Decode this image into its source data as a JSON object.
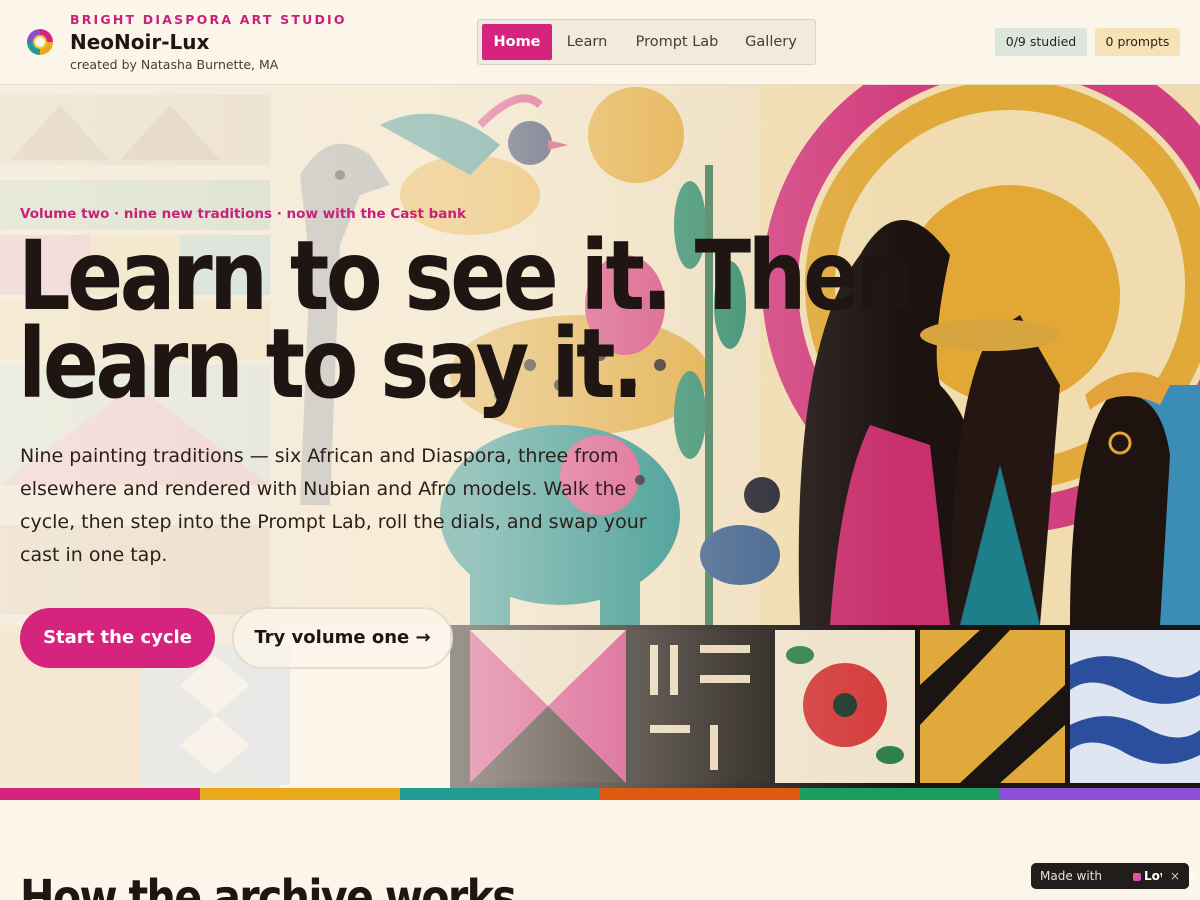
{
  "header": {
    "studio": "BRIGHT DIASPORA ART STUDIO",
    "brand": "NeoNoir-Lux",
    "byline": "created by Natasha Burnette, MA",
    "logo_icon": "ring-logo-icon"
  },
  "nav": {
    "items": [
      {
        "label": "Home",
        "active": true
      },
      {
        "label": "Learn",
        "active": false
      },
      {
        "label": "Prompt Lab",
        "active": false
      },
      {
        "label": "Gallery",
        "active": false
      }
    ]
  },
  "stats": {
    "studied": "0/9 studied",
    "prompts": "0 prompts"
  },
  "hero": {
    "eyebrow": "Volume two · nine new traditions · now with the Cast bank",
    "headline": "Learn to see it. Then learn to say it.",
    "lede": "Nine painting traditions — six African and Diaspora, three from elsewhere and rendered with Nubian and Afro models. Walk the cycle, then step into the Prompt Lab, roll the dials, and swap your cast in one tap.",
    "primary_cta": "Start the cycle",
    "secondary_cta": "Try volume one →"
  },
  "colors": {
    "accent": "#d6237d",
    "strip": [
      "#d6237d",
      "#e8a91d",
      "#1f9c94",
      "#e0590f",
      "#1d9c60",
      "#8a4fd6"
    ]
  },
  "section": {
    "title": "How the archive works"
  },
  "badge": {
    "made_with": "Made with",
    "brand": "Lovable",
    "close": "×"
  }
}
